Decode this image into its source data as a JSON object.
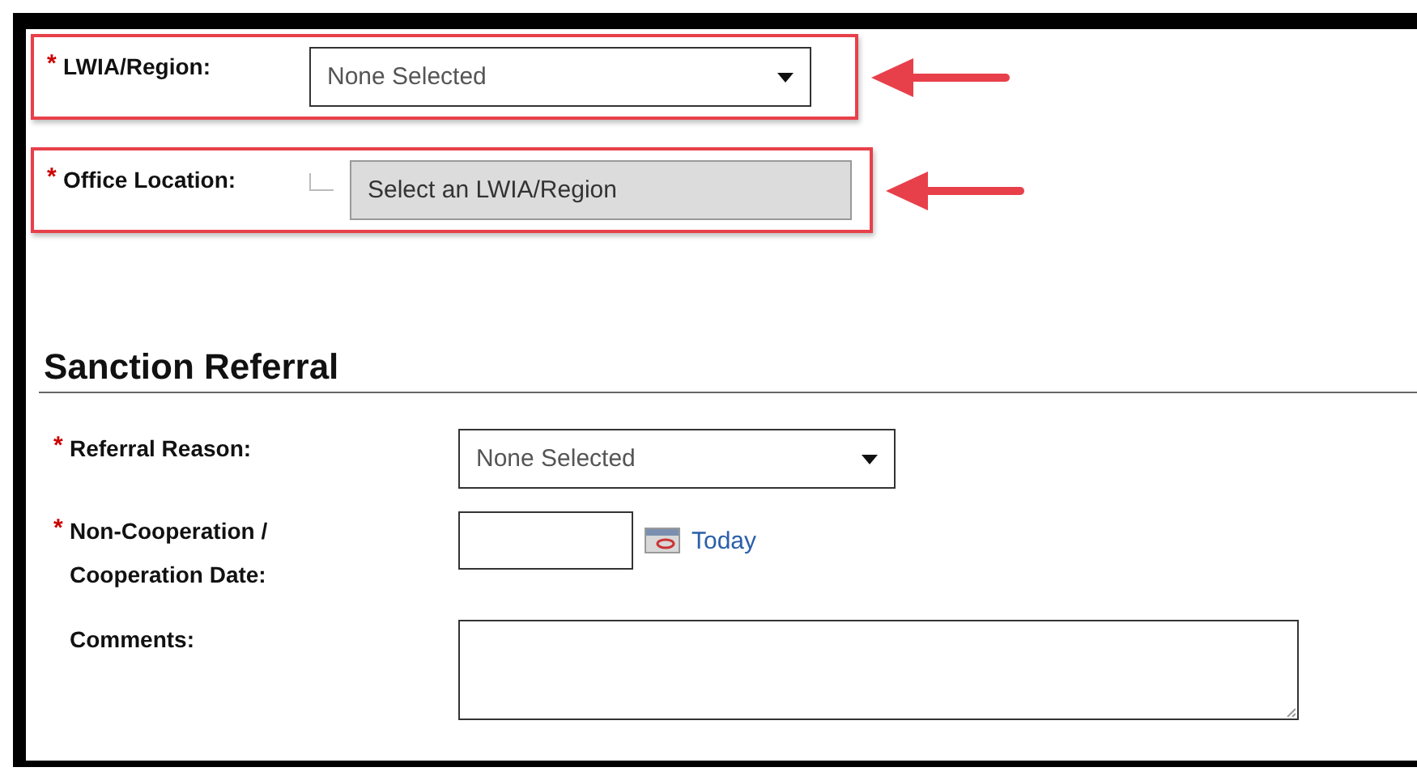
{
  "location_fields": [
    {
      "label": "LWIA/Region:",
      "marker": "*",
      "kind": "dropdown",
      "value": "None Selected",
      "disabled": false,
      "highlighted": true
    },
    {
      "label": "Office Location:",
      "marker": "*",
      "kind": "dropdown",
      "value": "Select an LWIA/Region",
      "disabled": true,
      "highlighted": true
    }
  ],
  "section": {
    "title": "Sanction Referral",
    "fields": [
      {
        "label": "Referral Reason:",
        "marker": "*",
        "kind": "dropdown",
        "value": "None Selected"
      },
      {
        "label": "Non-Cooperation / Cooperation Date:",
        "marker": "*",
        "kind": "date",
        "link": "Today"
      },
      {
        "label": "Comments:",
        "kind": "textarea"
      }
    ]
  }
}
